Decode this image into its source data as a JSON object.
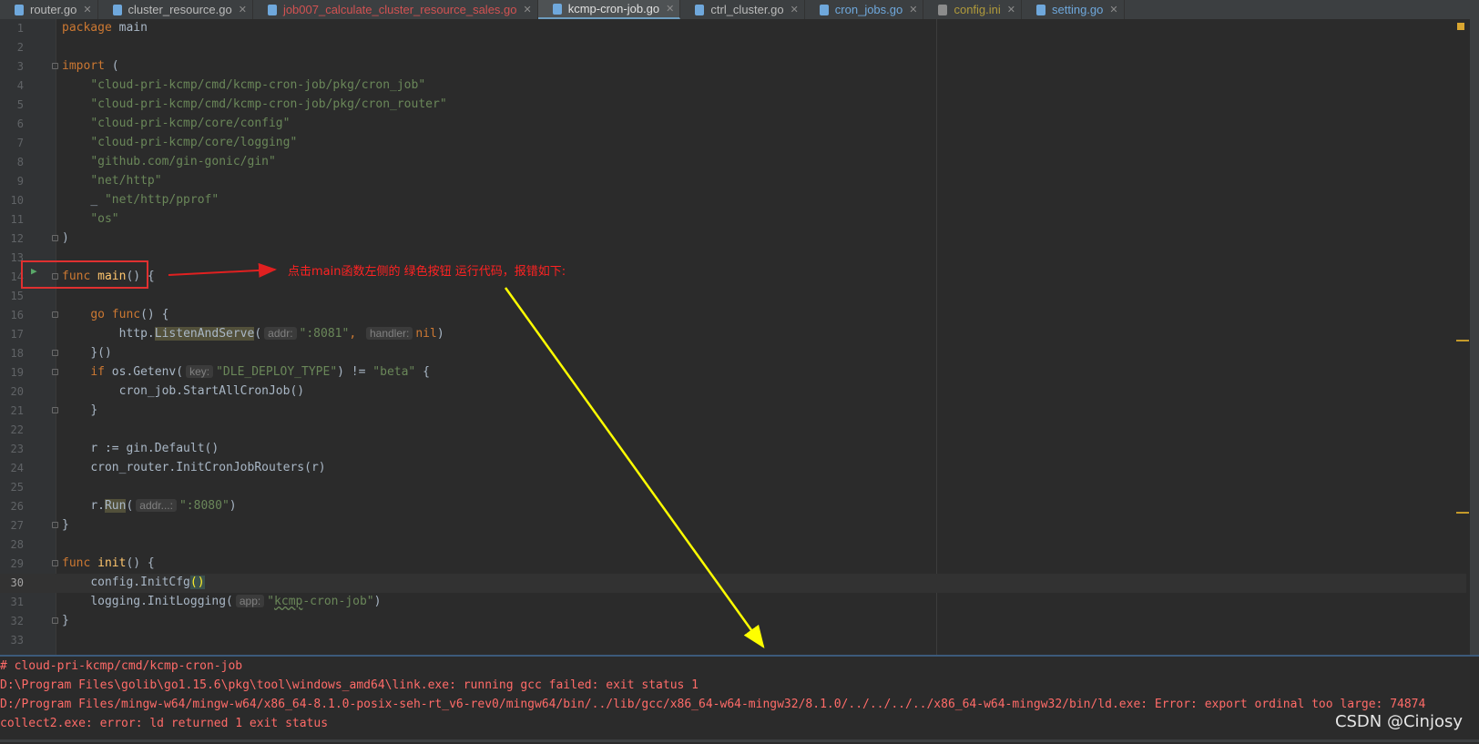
{
  "tabs": [
    {
      "label": "router.go",
      "style": "normal"
    },
    {
      "label": "cluster_resource.go",
      "style": "normal"
    },
    {
      "label": "job007_calculate_cluster_resource_sales.go",
      "style": "err"
    },
    {
      "label": "kcmp-cron-job.go",
      "style": "active"
    },
    {
      "label": "ctrl_cluster.go",
      "style": "normal"
    },
    {
      "label": "cron_jobs.go",
      "style": "mod"
    },
    {
      "label": "config.ini",
      "style": "ini"
    },
    {
      "label": "setting.go",
      "style": "mod"
    }
  ],
  "code": {
    "l1_kw": "package",
    "l1_name": "main",
    "l3_kw": "import",
    "l3_p": "(",
    "imports": [
      "\"cloud-pri-kcmp/cmd/kcmp-cron-job/pkg/cron_job\"",
      "\"cloud-pri-kcmp/cmd/kcmp-cron-job/pkg/cron_router\"",
      "\"cloud-pri-kcmp/core/config\"",
      "\"cloud-pri-kcmp/core/logging\"",
      "\"github.com/gin-gonic/gin\"",
      "\"net/http\""
    ],
    "l10_blank": "_",
    "l10_str": "\"net/http/pprof\"",
    "l11_str": "\"os\"",
    "l12": ")",
    "l14_kw": "func",
    "l14_fn": "main",
    "l14_rest": "() {",
    "l16_kw1": "go",
    "l16_kw2": "func",
    "l16_rest": "() {",
    "l17_pkg": "http.",
    "l17_fn": "ListenAndServe",
    "l17_open": "(",
    "l17_hint1": "addr:",
    "l17_str": "\":8081\"",
    "l17_comma": ",",
    "l17_hint2": "handler:",
    "l17_nil": "nil",
    "l17_close": ")",
    "l18": "}()",
    "l19_kw": "if",
    "l19_pkg": "os.Getenv(",
    "l19_hint": "key:",
    "l19_str": "\"DLE_DEPLOY_TYPE\"",
    "l19_op": ") != ",
    "l19_str2": "\"beta\"",
    "l19_end": " {",
    "l20": "cron_job.StartAllCronJob()",
    "l21": "}",
    "l23": "r := gin.Default()",
    "l24": "cron_router.InitCronJobRouters(r)",
    "l26_pre": "r.",
    "l26_fn": "Run",
    "l26_open": "(",
    "l26_hint": "addr...:",
    "l26_str": "\":8080\"",
    "l26_close": ")",
    "l27": "}",
    "l29_kw": "func",
    "l29_fn": "init",
    "l29_rest": "() {",
    "l30_pre": "config.InitCfg",
    "l30_paren": "()",
    "l31_pre": "logging.InitLogging(",
    "l31_hint": "app:",
    "l31_q1": "\"",
    "l31_typo": "kcmp",
    "l31_rest": "-cron-job\"",
    "l31_close": ")",
    "l32": "}"
  },
  "line_numbers": [
    "1",
    "2",
    "3",
    "4",
    "5",
    "6",
    "7",
    "8",
    "9",
    "10",
    "11",
    "12",
    "13",
    "14",
    "15",
    "16",
    "17",
    "18",
    "19",
    "20",
    "21",
    "22",
    "23",
    "24",
    "25",
    "26",
    "27",
    "28",
    "29",
    "30",
    "31",
    "32",
    "33"
  ],
  "annotation": "点击main函数左侧的 绿色按钮 运行代码，报错如下:",
  "console": [
    "# cloud-pri-kcmp/cmd/kcmp-cron-job",
    "D:\\Program Files\\golib\\go1.15.6\\pkg\\tool\\windows_amd64\\link.exe: running gcc failed: exit status 1",
    "D:/Program Files/mingw-w64/mingw-w64/x86_64-8.1.0-posix-seh-rt_v6-rev0/mingw64/bin/../lib/gcc/x86_64-w64-mingw32/8.1.0/../../../../x86_64-w64-mingw32/bin/ld.exe: Error: export ordinal too large: 74874",
    "collect2.exe: error: ld returned 1 exit status"
  ],
  "watermark": "CSDN @Cinjosy",
  "colors": {
    "keyword": "#cc7832",
    "string": "#6a8759",
    "function": "#ffc66d",
    "error": "#ff6b68",
    "annotation": "#ff2222",
    "arrow_red": "#e02020",
    "arrow_yellow": "#ffff00"
  }
}
